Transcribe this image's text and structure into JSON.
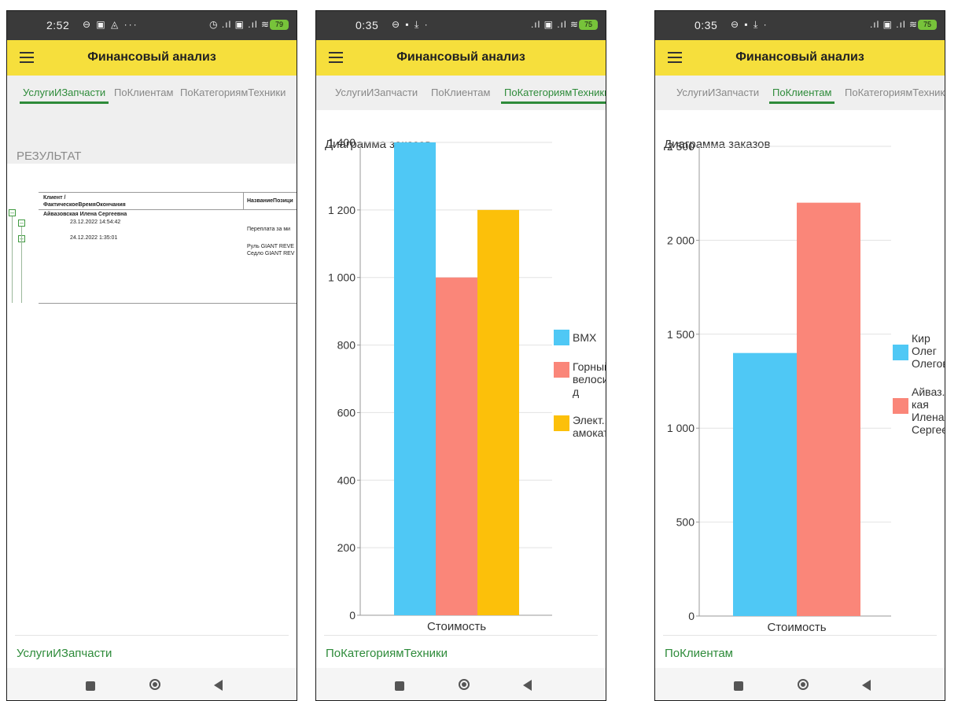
{
  "screens": [
    {
      "status": {
        "time": "2:52",
        "icons": "⊖ ▣ ◬ ···",
        "right": "◷ .ıl ▣ .ıl ≋",
        "battery": "79"
      },
      "app_title": "Финансовый анализ",
      "tabs": [
        "УслугиИЗапчасти",
        "ПоКлиентам",
        "ПоКатегориямТехники"
      ],
      "active_tab": 0,
      "result_title": "РЕЗУЛЬТАТ",
      "report": {
        "col1_header_1": "Клиент /",
        "col1_header_2": "ФактическоеВремяОкончания",
        "col2_header": "НазваниеПозици",
        "client": "Айвазовская Илена Сергеевна",
        "date1": "23.12.2022 14:54:42",
        "date2": "24.12.2022 1:35:01",
        "item1": "Переплата за ми",
        "item2": "Руль GIANT REVE",
        "item3": "Седло GIANT REV"
      },
      "bottom_label": "УслугиИЗапчасти"
    },
    {
      "status": {
        "time": "0:35",
        "icons": "⊖ ▪ ⤓ ·",
        "right": ".ıl ▣ .ıl ≋",
        "battery": "75"
      },
      "app_title": "Финансовый анализ",
      "tabs": [
        "УслугиИЗапчасти",
        "ПоКлиентам",
        "ПоКатегориямТехники"
      ],
      "active_tab": 2,
      "bottom_label": "ПоКатегориямТехники"
    },
    {
      "status": {
        "time": "0:35",
        "icons": "⊖ ▪ ⤓ ·",
        "right": ".ıl ▣ .ıl ≋",
        "battery": "75"
      },
      "app_title": "Финансовый анализ",
      "tabs": [
        "УслугиИЗапчасти",
        "ПоКлиентам",
        "ПоКатегориямТехники"
      ],
      "active_tab": 1,
      "bottom_label": "ПоКлиентам"
    }
  ],
  "chart_data": [
    {
      "type": "bar",
      "title": "Диаграмма заказов",
      "categories": [
        "Стоимость"
      ],
      "ylim": [
        0,
        1400
      ],
      "yticks": [
        0,
        200,
        400,
        600,
        800,
        1000,
        1200,
        1400
      ],
      "ytick_labels": [
        "0",
        "200",
        "400",
        "600",
        "800",
        "1 000",
        "1 200",
        "1 400"
      ],
      "grid": true,
      "legend_position": "right",
      "series": [
        {
          "name": "BMX",
          "legend_lines": [
            "BMX"
          ],
          "values": [
            1400
          ],
          "color": "#4fc8f5"
        },
        {
          "name": "Горный велоси... д",
          "legend_lines": [
            "Горный",
            "велоси...",
            "д"
          ],
          "values": [
            1000
          ],
          "color": "#fa8679"
        },
        {
          "name": "Элект... амокат",
          "legend_lines": [
            "Элект...",
            "амокат"
          ],
          "values": [
            1200
          ],
          "color": "#fcc00a"
        }
      ]
    },
    {
      "type": "bar",
      "title": "Диаграмма заказов",
      "categories": [
        "Стоимость"
      ],
      "ylim": [
        0,
        2500
      ],
      "yticks": [
        0,
        500,
        1000,
        1500,
        2000,
        2500
      ],
      "ytick_labels": [
        "0",
        "500",
        "1 000",
        "1 500",
        "2 000",
        "2 500"
      ],
      "grid": true,
      "legend_position": "right",
      "series": [
        {
          "name": "Кир Олег Олегов...",
          "legend_lines": [
            "Кир",
            "Олег",
            "Олегов..."
          ],
          "values": [
            1400
          ],
          "color": "#4fc8f5"
        },
        {
          "name": "Айваз... кая Илена Сергее...",
          "legend_lines": [
            "Айваз...",
            "кая",
            "Илена",
            "Сергее..."
          ],
          "values": [
            2200
          ],
          "color": "#fa8679"
        }
      ]
    }
  ]
}
